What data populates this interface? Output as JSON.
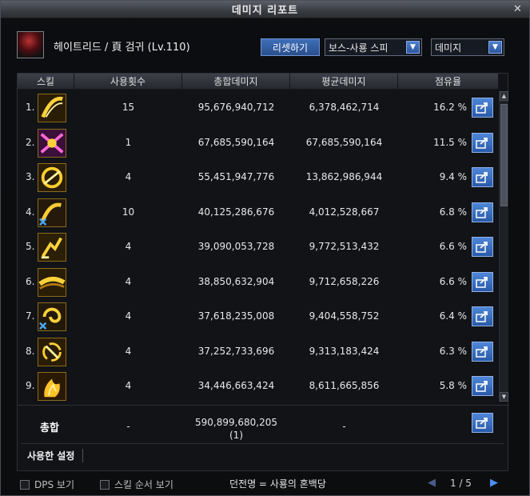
{
  "window": {
    "title": "데미지 리포트",
    "close_glyph": "✕"
  },
  "header": {
    "character_name": "헤이트리드 / 頁 검귀 (Lv.110)",
    "reset_label": "리셋하기",
    "boss_select_value": "보스-사룡 스피",
    "metric_select_value": "데미지",
    "dropdown_glyph": "▼"
  },
  "table": {
    "columns": [
      "스킬",
      "사용횟수",
      "총합데미지",
      "평균데미지",
      "점유율"
    ],
    "rows": [
      {
        "rank": "1.",
        "icon": "slash-arc-skill-icon",
        "uses": "15",
        "total": "95,676,940,712",
        "avg": "6,378,462,714",
        "share": "16.2 %"
      },
      {
        "rank": "2.",
        "icon": "cross-slash-skill-icon",
        "uses": "1",
        "total": "67,685,590,164",
        "avg": "67,685,590,164",
        "share": "11.5 %"
      },
      {
        "rank": "3.",
        "icon": "crescent-skill-icon",
        "uses": "4",
        "total": "55,451,947,776",
        "avg": "13,862,986,944",
        "share": "9.4 %"
      },
      {
        "rank": "4.",
        "icon": "blue-mark-slash-skill-icon",
        "uses": "10",
        "total": "40,125,286,676",
        "avg": "4,012,528,667",
        "share": "6.8 %"
      },
      {
        "rank": "5.",
        "icon": "lunge-skill-icon",
        "uses": "4",
        "total": "39,090,053,728",
        "avg": "9,772,513,432",
        "share": "6.6 %"
      },
      {
        "rank": "6.",
        "icon": "sweep-skill-icon",
        "uses": "4",
        "total": "38,850,632,904",
        "avg": "9,712,658,226",
        "share": "6.6 %"
      },
      {
        "rank": "7.",
        "icon": "vortex-skill-icon",
        "uses": "4",
        "total": "37,618,235,008",
        "avg": "9,404,558,752",
        "share": "6.4 %"
      },
      {
        "rank": "8.",
        "icon": "spin-slash-skill-icon",
        "uses": "4",
        "total": "37,252,733,696",
        "avg": "9,313,183,424",
        "share": "6.3 %"
      },
      {
        "rank": "9.",
        "icon": "flame-slash-skill-icon",
        "uses": "4",
        "total": "34,446,663,424",
        "avg": "8,611,665,856",
        "share": "5.8 %"
      }
    ],
    "total": {
      "label": "총합",
      "uses": "-",
      "total": "590,899,680,205",
      "total_count": "(1)",
      "avg": "-"
    },
    "settings_label": "사용한 설정",
    "scroll_up_glyph": "▲",
    "scroll_down_glyph": "▼"
  },
  "footer": {
    "dps_label": "DPS 보기",
    "skill_order_label": "스킬 순서 보기",
    "dungeon": "던전명 = 사룡의 혼백당",
    "prev_glyph": "◀",
    "next_glyph": "▶",
    "page": "1 / 5"
  },
  "colors": {
    "accent": "#2f64b8",
    "gold": "#f0c020"
  }
}
